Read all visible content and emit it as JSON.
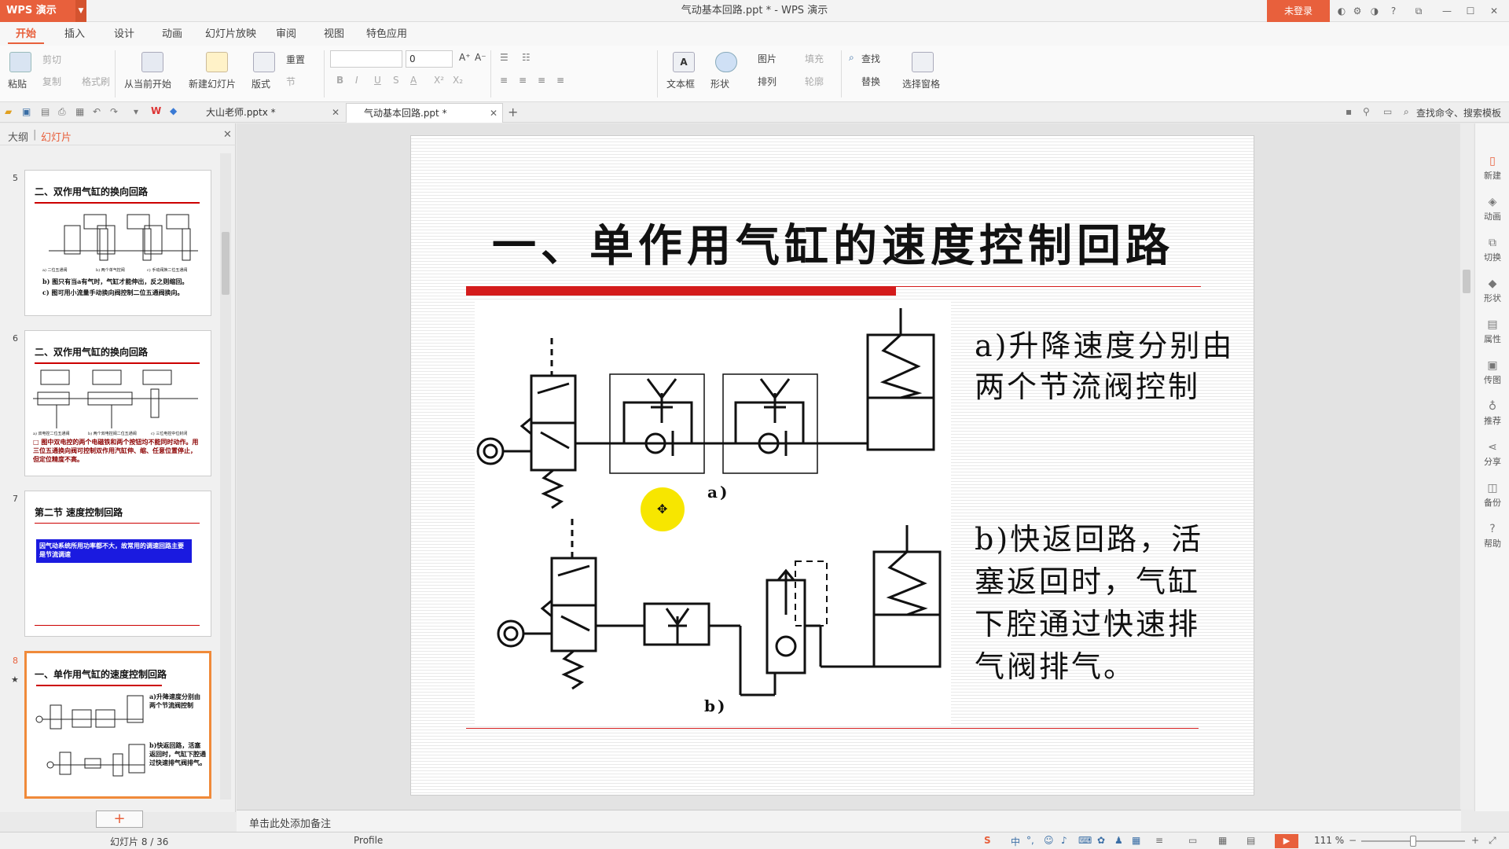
{
  "app": {
    "name": "WPS 演示",
    "window_title": "气动基本回路.ppt * - WPS 演示",
    "login_label": "未登录"
  },
  "menu": {
    "tabs": [
      "开始",
      "插入",
      "设计",
      "动画",
      "幻灯片放映",
      "审阅",
      "视图",
      "特色应用"
    ],
    "active": "开始"
  },
  "ribbon": {
    "paste": "粘贴",
    "cut": "剪切",
    "copy": "复制",
    "format_painter": "格式刷",
    "from_current": "从当前开始",
    "new_slide": "新建幻灯片",
    "layout": "版式",
    "reset": "重置",
    "section": "节",
    "font_name": "",
    "font_size": "0",
    "text_box": "文本框",
    "shapes": "形状",
    "picture": "图片",
    "fill": "填充",
    "arrange": "排列",
    "outline": "轮廓",
    "find": "查找",
    "replace": "替换",
    "selection_pane": "选择窗格",
    "format_bold": "B",
    "format_italic": "I",
    "format_underline": "U",
    "format_strike": "S",
    "font_color": "A",
    "superscript": "X²",
    "subscript": "X₂",
    "grow_font": "A⁺",
    "shrink_font": "A⁻"
  },
  "doc_tabs": [
    {
      "label": "大山老师.pptx *",
      "active": false
    },
    {
      "label": "气动基本回路.ppt *",
      "active": true
    }
  ],
  "search": {
    "label": "查找命令、搜索模板"
  },
  "left_panel": {
    "tab_outline": "大纲",
    "tab_slides": "幻灯片",
    "add_label": "+",
    "slides": [
      {
        "num": "5",
        "title": "二、双作用气缸的换向回路",
        "line1": "b) 图只有当a有气时，气缸才能伸出，反之则缩回。",
        "line2": "c) 图可用小流量手动换向阀控制二位五通阀换向。",
        "captions": [
          "a) 二位五通阀",
          "b) 两个单气控阀",
          "c) 手动阀换二位五通阀"
        ]
      },
      {
        "num": "6",
        "title": "二、双作用气缸的换向回路",
        "line1": "□ 图中双电控的两个电磁铁和两个按钮均不能同时动作。用三位五通换向阀可控制双作用汽缸伸、缩、任意位置停止，但定位精度不高。",
        "captions": [
          "a) 双电控二位五通阀",
          "b) 两个双电控阀二位五通阀",
          "c) 三位电控中位封闭"
        ]
      },
      {
        "num": "7",
        "title": "第二节   速度控制回路",
        "box": "因气动系统所用功率都不大，故常用的调速回路主要是节流调速"
      },
      {
        "num": "8",
        "title": "一、单作用气缸的速度控制回路",
        "text_a": "a)升降速度分别由两个节流阀控制",
        "text_b": "b)快返回路，活塞返回时，气缸下腔通过快速排气阀排气。",
        "star": "★"
      }
    ]
  },
  "slide": {
    "title": "一、单作用气缸的速度控制回路",
    "text_a_line1": "a)升降速度分别由",
    "text_a_line2": "两个节流阀控制",
    "text_b_line1": "b)快返回路，活",
    "text_b_line2": "塞返回时，气缸",
    "text_b_line3": "下腔通过快速排",
    "text_b_line4": "气阀排气。",
    "label_a": "a)",
    "label_b": "b)"
  },
  "notes_placeholder": "单击此处添加备注",
  "right_sidebar": [
    "新建",
    "动画",
    "切换",
    "形状",
    "属性",
    "传图",
    "推荐",
    "分享",
    "备份",
    "帮助"
  ],
  "status": {
    "slide_count": "幻灯片 8 / 36",
    "profile": "Profile",
    "zoom": "111 %",
    "input_method": "中"
  },
  "colors": {
    "accent": "#e8603c",
    "title_red": "#d41c1c",
    "cursor_highlight": "#f7e600",
    "blue_box": "#1a1ae0"
  }
}
